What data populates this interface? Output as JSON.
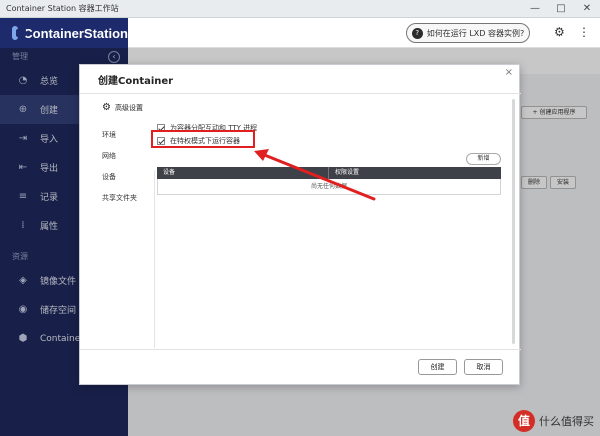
{
  "window": {
    "title": "Container Station 容器工作站",
    "minimize": "—",
    "maximize": "□",
    "close": "✕"
  },
  "header": {
    "app_name": "ContainerStation",
    "lxd_button": "如何在运行 LXD 容器实例?",
    "lxd_icon": "?",
    "icons": [
      "gear-icon",
      "more-icon"
    ]
  },
  "sidebar": {
    "section_manage": "管理",
    "collapse_icon": "‹",
    "items": [
      {
        "label": "总览",
        "icon": "◔"
      },
      {
        "label": "创建",
        "icon": "⊕"
      },
      {
        "label": "导入",
        "icon": "⇥"
      },
      {
        "label": "导出",
        "icon": "⇤"
      },
      {
        "label": "记录",
        "icon": "≡"
      },
      {
        "label": "属性",
        "icon": "⁞"
      }
    ],
    "section_resources": "资源",
    "resource_items": [
      {
        "label": "镜像文件",
        "icon": "◈"
      },
      {
        "label": "储存空间",
        "icon": "◉"
      },
      {
        "label": "Container",
        "icon": "⬢"
      }
    ]
  },
  "background": {
    "create_app_button": "+ 创建应用程序",
    "install_button": "安装",
    "delete_button": "删除"
  },
  "modal": {
    "title": "创建Container",
    "close": "×",
    "advanced_settings": "高级设置",
    "nav": [
      "环境",
      "网络",
      "设备",
      "共享文件夹"
    ],
    "checkbox_tty": "为容器分配互动和 TTY 进程",
    "checkbox_privileged": "在特权模式下运行容器",
    "add_button": "新增",
    "table_headers": [
      "设备",
      "权限设置"
    ],
    "table_empty": "尚无任何数据",
    "create_button": "创建",
    "cancel_button": "取消"
  },
  "annotation": {
    "color": "#e02020"
  },
  "watermark": {
    "logo": "值",
    "text": "什么值得买"
  }
}
